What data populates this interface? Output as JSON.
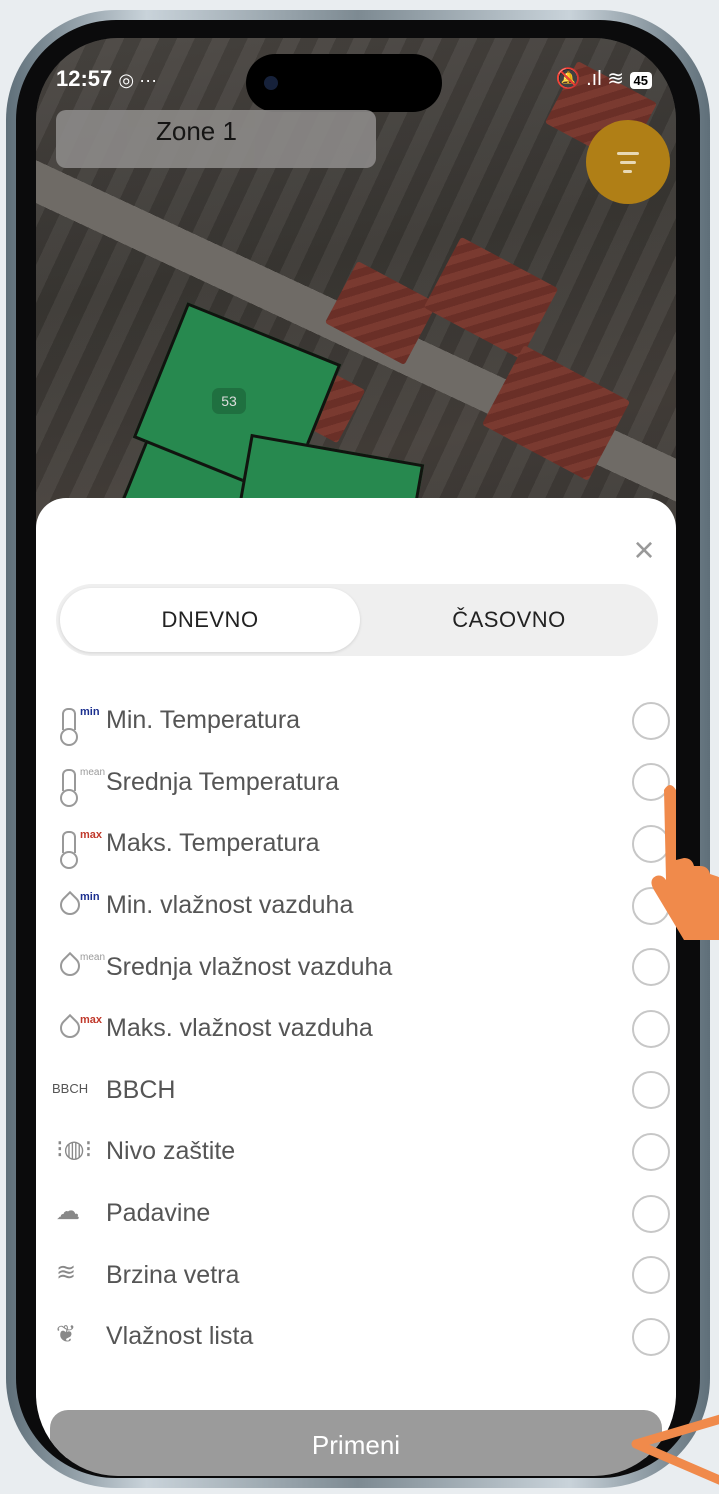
{
  "status_bar": {
    "time": "12:57",
    "notification_icons": "◎ ···",
    "right_icons": "🔕 .ıl ≋",
    "battery": "45"
  },
  "map": {
    "zone_label": "Zone 1",
    "field_label": "53",
    "filter_icon": "filter-icon"
  },
  "sheet": {
    "close_icon": "close-icon",
    "tabs": [
      {
        "label": "DNEVNO",
        "active": true
      },
      {
        "label": "ČASOVNO",
        "active": false
      }
    ],
    "items": [
      {
        "label": "Min. Temperatura",
        "icon": "thermometer-min-icon",
        "tag": "min",
        "tag_color": "#1b2f8f"
      },
      {
        "label": "Srednja Temperatura",
        "icon": "thermometer-mean-icon",
        "tag": "mean",
        "tag_color": "#9a9a9a"
      },
      {
        "label": "Maks. Temperatura",
        "icon": "thermometer-max-icon",
        "tag": "max",
        "tag_color": "#c0392b"
      },
      {
        "label": "Min. vlažnost vazduha",
        "icon": "humidity-min-icon",
        "tag": "min",
        "tag_color": "#1b2f8f"
      },
      {
        "label": "Srednja vlažnost vazduha",
        "icon": "humidity-mean-icon",
        "tag": "mean",
        "tag_color": "#9a9a9a"
      },
      {
        "label": "Maks. vlažnost vazduha",
        "icon": "humidity-max-icon",
        "tag": "max",
        "tag_color": "#c0392b"
      },
      {
        "label": "BBCH",
        "icon": "bbch-icon",
        "tag": "BBCH"
      },
      {
        "label": "Nivo zaštite",
        "icon": "protection-level-icon"
      },
      {
        "label": "Padavine",
        "icon": "rain-cloud-icon"
      },
      {
        "label": "Brzina vetra",
        "icon": "wind-icon"
      },
      {
        "label": "Vlažnost lista",
        "icon": "leaf-wetness-icon"
      }
    ],
    "apply_label": "Primeni"
  },
  "overlay": {
    "pointer_hand": "pointing-hand-icon",
    "arrow": "arrow-left-icon",
    "accent_color": "#f08a4b"
  }
}
